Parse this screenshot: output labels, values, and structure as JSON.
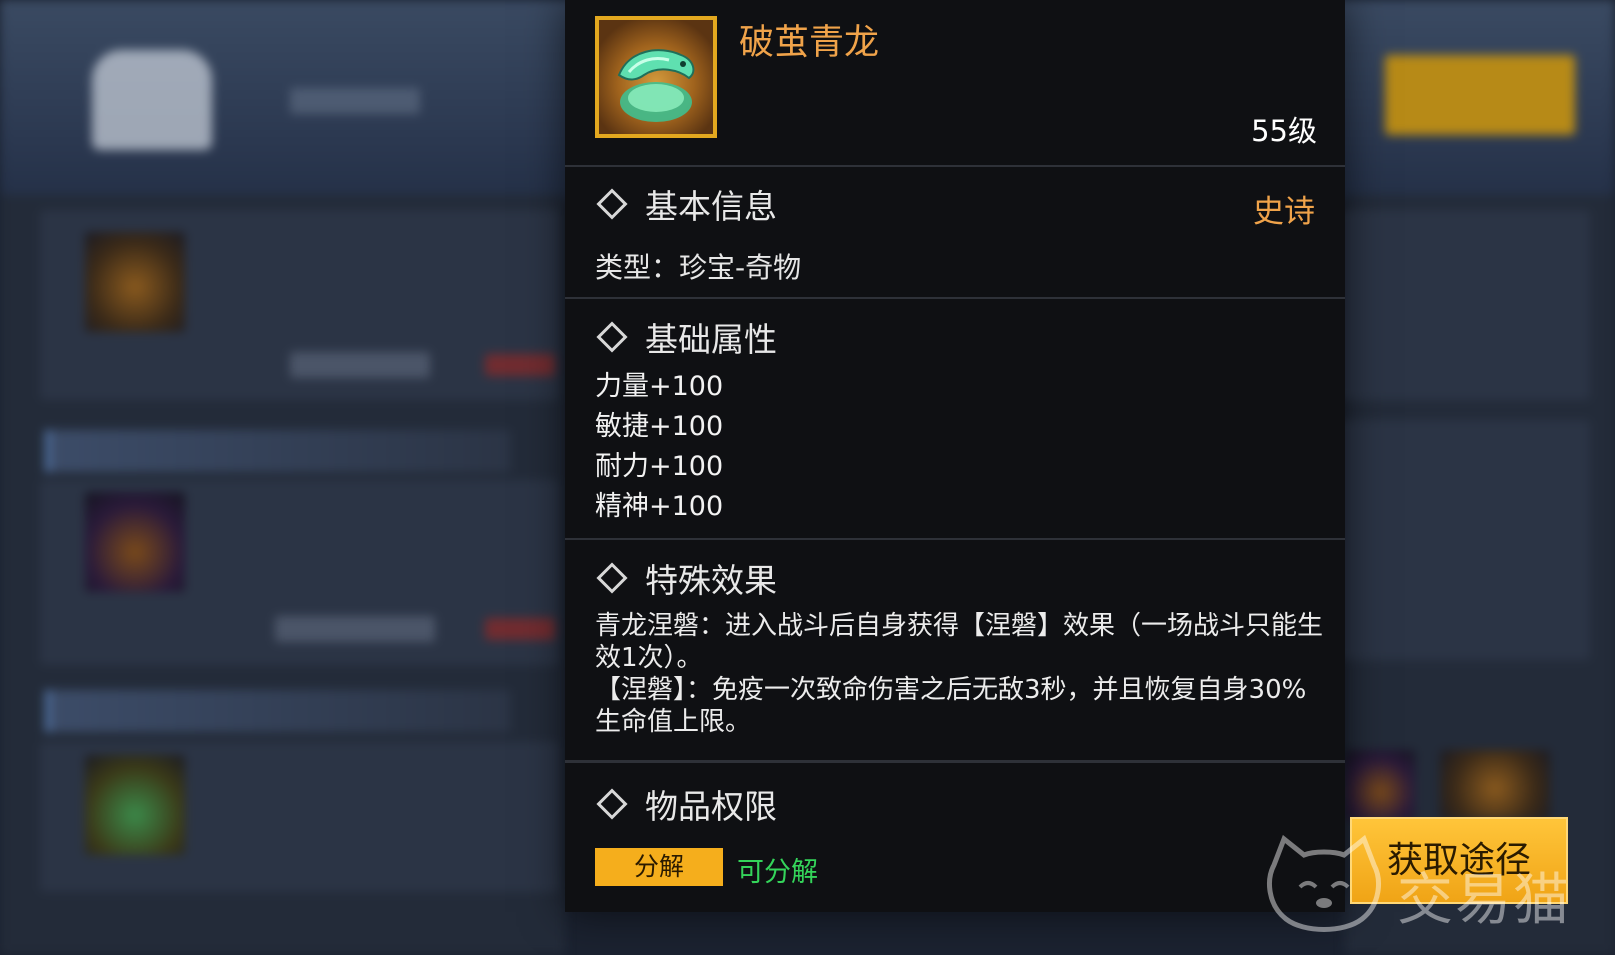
{
  "item": {
    "name": "破茧青龙",
    "level": "55级",
    "icon": "jade-dragon-icon"
  },
  "basic_info": {
    "title": "基本信息",
    "rarity": "史诗",
    "type_line": "类型：珍宝-奇物"
  },
  "base_attributes": {
    "title": "基础属性",
    "items": [
      "力量+100",
      "敏捷+100",
      "耐力+100",
      "精神+100"
    ]
  },
  "special_effect": {
    "title": "特殊效果",
    "paragraph1": "青龙涅磐：进入战斗后自身获得【涅磐】效果（一场战斗只能生效1次）。",
    "paragraph2": "【涅磐】：免疫一次致命伤害之后无敌3秒，并且恢复自身30%生命值上限。"
  },
  "permissions": {
    "title": "物品权限",
    "tag": "分解",
    "status": "可分解"
  },
  "actions": {
    "get_path": "获取途径"
  },
  "watermark": {
    "text": "交易猫",
    "icon": "cat-logo-icon"
  },
  "colors": {
    "item_name": "#f0a34a",
    "rarity_epic": "#f0a34a",
    "decomposable": "#34d45a",
    "accent_gold": "#f5ae1c",
    "panel_bg": "#0f1013"
  }
}
